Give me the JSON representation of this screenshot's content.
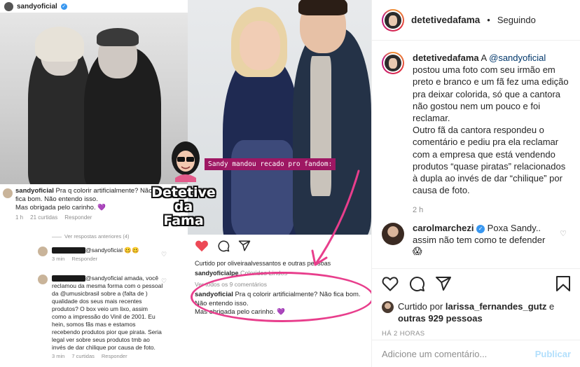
{
  "image_panel": {
    "left_screenshot": {
      "username": "sandyoficial",
      "comment_user": "sandyoficial",
      "comment_text": " Pra q colorir artificialmente? Não fica bom. Não entendo isso.",
      "comment_line2": "Mas obrigada pelo carinho. 💜",
      "comment_time": "1 h",
      "comment_likes": "21 curtidas",
      "comment_reply": "Responder",
      "view_previous": "Ver respostas anteriores (4)",
      "reply1_text": "@sandyoficial 🥴🥴",
      "reply1_time": "3 min",
      "reply1_action": "Responder",
      "reply2_text": "@sandyoficial amada, você reclamou da mesma forma com o pessoal da @umusicbrasil sobre a (falta de ) qualidade dos seus mais recentes produtos? O box veio um lixo, assim como a impressão do Vinil de 2001. Eu hein, somos fãs mas e estamos recebendo produtos pior que pirata. Seria legal ver sobre seus produtos tmb ao invés de dar chilique por causa de foto.",
      "reply2_time": "3 min",
      "reply2_likes": "7 curtidas",
      "reply2_action": "Responder"
    },
    "logo": {
      "line1": "Detetive",
      "line2": "da",
      "line3": "Fama"
    },
    "right_screenshot": {
      "overlay_caption": "Sandy mandou recado pro fandom:",
      "liked_by": "Curtido por oliveiraalvessantos e outras pessoas",
      "caption_user": "sandyoficialpe",
      "caption_text": " Coloridos Lindos",
      "view_all": "Ver todos os 9 comentários",
      "comment_user": "sandyoficial",
      "comment_text": " Pra q colorir artificialmente? Não fica bom. Não entendo isso.",
      "comment_line2": "Mas obrigada pelo carinho. 💜"
    }
  },
  "sidebar": {
    "header": {
      "username": "detetivedafama",
      "separator": "•",
      "follow_status": "Seguindo"
    },
    "caption": {
      "username": "detetivedafama",
      "text_before_mention": " A ",
      "mention": "@sandyoficial",
      "text_after_mention": " postou uma foto com seu irmão em preto e branco e um fã fez uma edição pra deixar colorida, só que a cantora não gostou nem um pouco e foi reclamar.",
      "paragraph2": "Outro fã da cantora respondeu o comentário e pediu pra ela reclamar com a empresa que está vendendo produtos “quase piratas” relacionados à dupla ao invés de dar “chilique” por causa de foto.",
      "time": "2 h"
    },
    "comment": {
      "username": "carolmarchezi",
      "text": " Poxa Sandy.. assim não tem como te defender 😱"
    },
    "liked_by": {
      "prefix": "Curtido por ",
      "user": "larissa_fernandes_gutz",
      "middle": " e ",
      "others": "outras 929 pessoas"
    },
    "post_time": "HÁ 2 HORAS",
    "add_comment": {
      "placeholder": "Adicione um comentário...",
      "publish_label": "Publicar"
    },
    "icons": [
      "heart-icon",
      "comment-icon",
      "share-icon",
      "bookmark-icon"
    ],
    "colors": {
      "accent_blue": "#3897f0",
      "mention": "#00376b",
      "muted": "#8e8e8e",
      "like_red": "#ed4956",
      "highlight_pink": "#e83e8c"
    }
  }
}
